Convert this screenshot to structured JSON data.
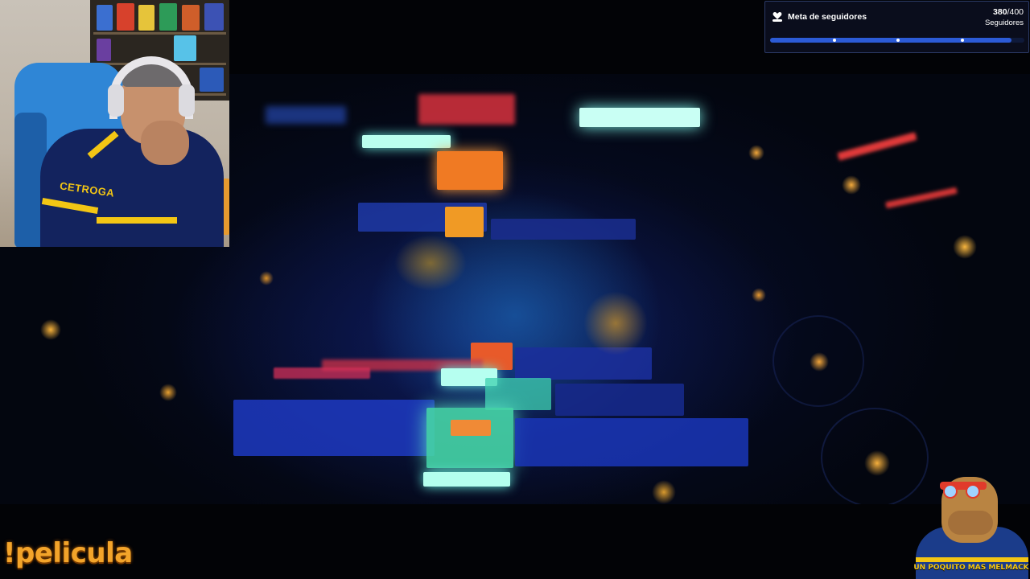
{
  "follower_goal": {
    "title": "Meta de seguidores",
    "current": "380",
    "total": "/400",
    "unit_label": "Seguidores",
    "progress": 0.95,
    "icon": "heart-hand-icon"
  },
  "webcam": {
    "jersey_sponsor": "CETROGA"
  },
  "chat_command": "!pelicula",
  "mascot": {
    "caption": "UN POQUITO MAS MELMACK"
  },
  "colors": {
    "goal_bar": "#2c5bd6",
    "command_text": "#f3a42a",
    "jersey_blue": "#13235e",
    "jersey_yellow": "#f3c614"
  }
}
